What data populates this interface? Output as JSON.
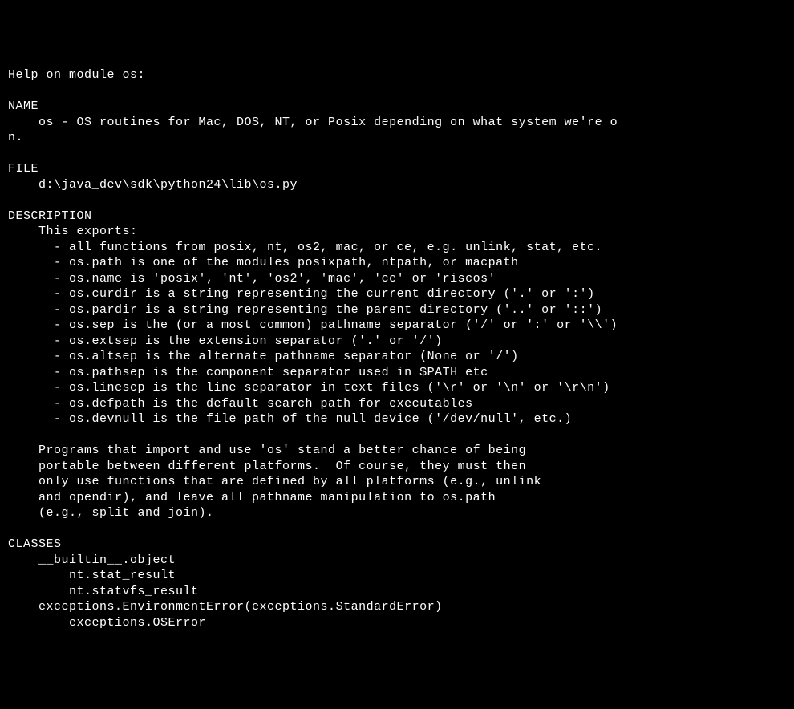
{
  "help": {
    "header": "Help on module os:",
    "name_section": {
      "title": "NAME",
      "content": "    os - OS routines for Mac, DOS, NT, or Posix depending on what system we're o\nn."
    },
    "file_section": {
      "title": "FILE",
      "content": "    d:\\java_dev\\sdk\\python24\\lib\\os.py"
    },
    "description_section": {
      "title": "DESCRIPTION",
      "intro": "    This exports:",
      "exports": [
        "      - all functions from posix, nt, os2, mac, or ce, e.g. unlink, stat, etc.",
        "      - os.path is one of the modules posixpath, ntpath, or macpath",
        "      - os.name is 'posix', 'nt', 'os2', 'mac', 'ce' or 'riscos'",
        "      - os.curdir is a string representing the current directory ('.' or ':')",
        "      - os.pardir is a string representing the parent directory ('..' or '::')",
        "      - os.sep is the (or a most common) pathname separator ('/' or ':' or '\\\\')",
        "      - os.extsep is the extension separator ('.' or '/')",
        "      - os.altsep is the alternate pathname separator (None or '/')",
        "      - os.pathsep is the component separator used in $PATH etc",
        "      - os.linesep is the line separator in text files ('\\r' or '\\n' or '\\r\\n')",
        "      - os.defpath is the default search path for executables",
        "      - os.devnull is the file path of the null device ('/dev/null', etc.)"
      ],
      "paragraph": "    Programs that import and use 'os' stand a better chance of being\n    portable between different platforms.  Of course, they must then\n    only use functions that are defined by all platforms (e.g., unlink\n    and opendir), and leave all pathname manipulation to os.path\n    (e.g., split and join)."
    },
    "classes_section": {
      "title": "CLASSES",
      "lines": [
        "    __builtin__.object",
        "        nt.stat_result",
        "        nt.statvfs_result",
        "    exceptions.EnvironmentError(exceptions.StandardError)",
        "        exceptions.OSError"
      ]
    }
  }
}
